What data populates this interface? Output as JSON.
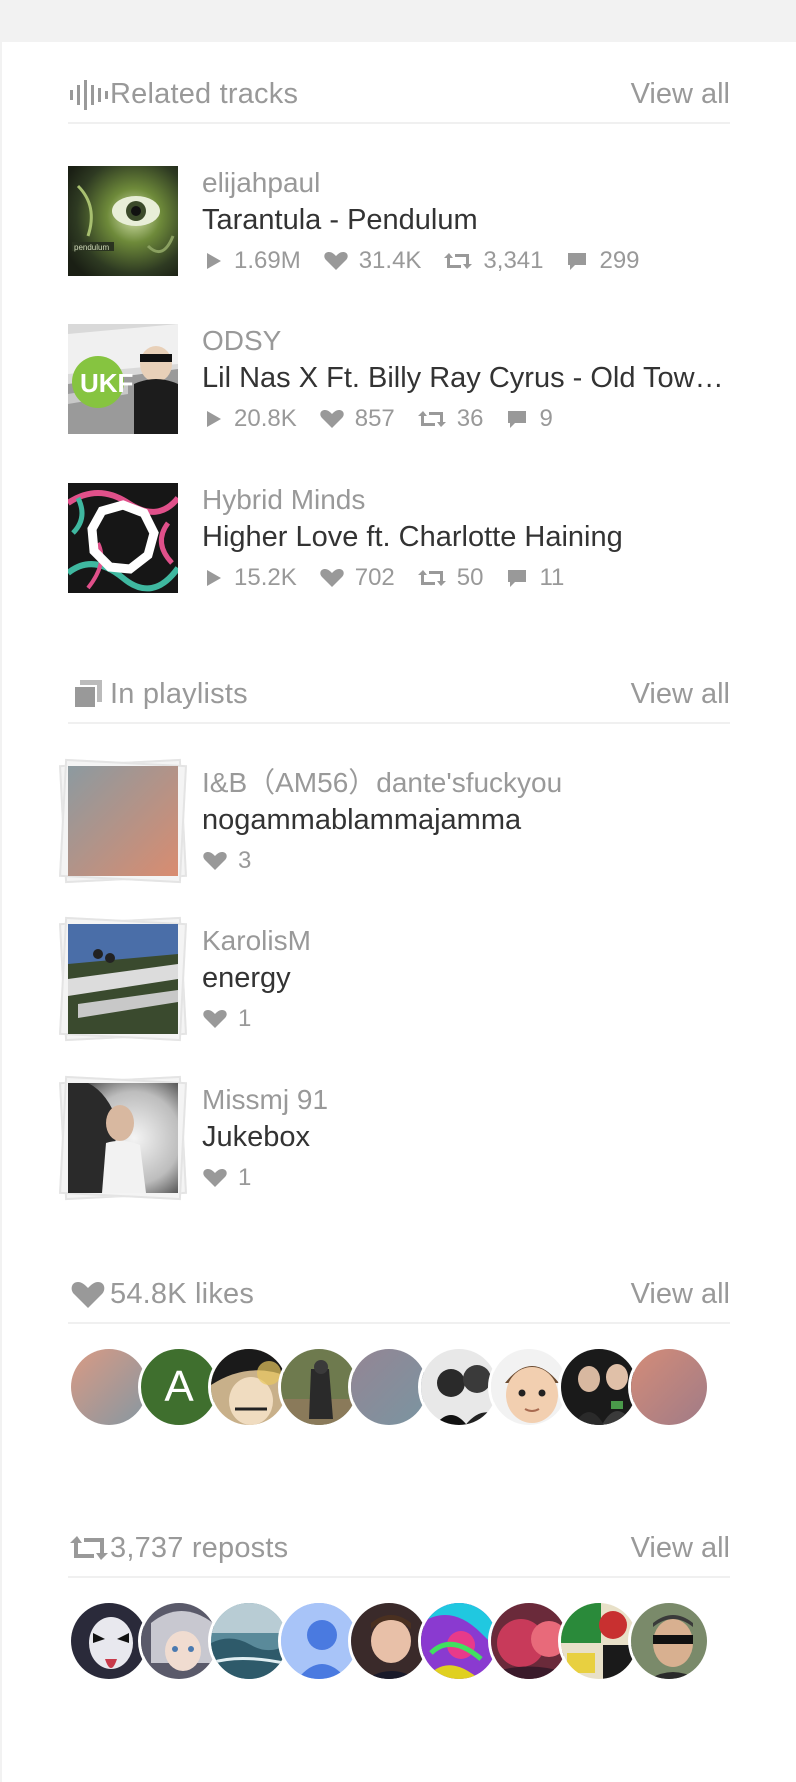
{
  "related": {
    "title": "Related tracks",
    "view_all": "View all",
    "icon": "waveform-icon",
    "tracks": [
      {
        "user": "elijahpaul",
        "title": "Tarantula - Pendulum",
        "plays": "1.69M",
        "likes": "31.4K",
        "reposts": "3,341",
        "comments": "299"
      },
      {
        "user": "ODSY",
        "title": "Lil Nas X Ft. Billy Ray Cyrus - Old Town Road (UKF Remix)",
        "plays": "20.8K",
        "likes": "857",
        "reposts": "36",
        "comments": "9"
      },
      {
        "user": "Hybrid Minds",
        "title": "Higher Love ft. Charlotte Haining",
        "plays": "15.2K",
        "likes": "702",
        "reposts": "50",
        "comments": "11"
      }
    ]
  },
  "playlists": {
    "title": "In playlists",
    "view_all": "View all",
    "icon": "playlist-stack-icon",
    "items": [
      {
        "user": "I&B（AM56）dante'sfuckyou",
        "title": "nogammablammajamma",
        "likes": "3"
      },
      {
        "user": "KarolisM",
        "title": "energy",
        "likes": "1"
      },
      {
        "user": "Missmj 91",
        "title": "Jukebox",
        "likes": "1"
      }
    ]
  },
  "likes": {
    "title": "54.8K likes",
    "view_all": "View all",
    "icon": "heart-icon",
    "avatar_letter": "A"
  },
  "reposts": {
    "title": "3,737 reposts",
    "view_all": "View all",
    "icon": "repost-icon"
  },
  "colors": {
    "muted_text": "#999999",
    "main_text": "#333333",
    "divider": "#f0f0f0",
    "avatar_green": "#3f6f2e"
  }
}
